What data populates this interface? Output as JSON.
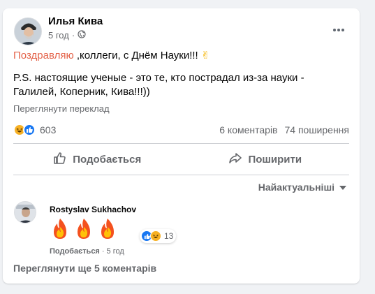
{
  "post": {
    "author": "Илья Кива",
    "time": "5 год",
    "dot": "·",
    "more_icon": "more-horizontal-icon",
    "text_highlight": "Поздравляю",
    "text_line1": " ,коллеги, с Днём Науки!!!",
    "text_line1_emoji": "✌",
    "text_line2": "P.S. настоящие ученые - это те, кто пострадал из-за науки - Галилей, Коперник, Кива!!!))",
    "translate_label": "Переглянути переклад",
    "reaction_count": "603",
    "comments_count": "6 коментарів",
    "shares_count": "74 поширення",
    "like_label": "Подобається",
    "share_label": "Поширити"
  },
  "comments": {
    "sort_label": "Найактуальніші",
    "items": [
      {
        "author": "Rostyslav Sukhachov",
        "content_emoji": "🔥🔥🔥",
        "reaction_count": "13",
        "like_label": "Подобається",
        "dot": "·",
        "time": "5 год"
      }
    ],
    "more_label": "Переглянути ще 5 коментарів"
  },
  "colors": {
    "highlight": "#e4634a",
    "like_blue": "#1877f2",
    "haha_yellow": "#f7b125",
    "muted": "#65676b"
  }
}
